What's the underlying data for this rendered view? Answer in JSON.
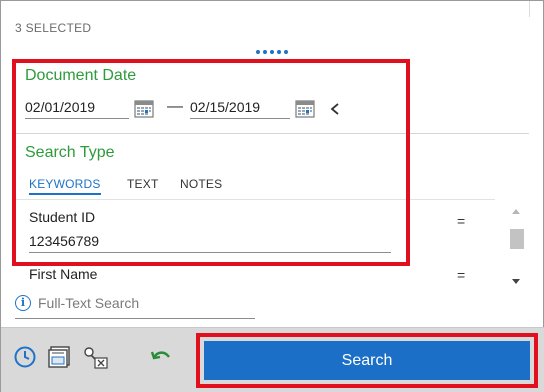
{
  "header": {
    "selected_count": "3 SELECTED"
  },
  "document_date": {
    "title": "Document Date",
    "from": "02/01/2019",
    "to": "02/15/2019",
    "separator": "—"
  },
  "search_type": {
    "title": "Search Type",
    "tabs": [
      {
        "label": "KEYWORDS",
        "active": true
      },
      {
        "label": "TEXT",
        "active": false
      },
      {
        "label": "NOTES",
        "active": false
      }
    ]
  },
  "fields": [
    {
      "label": "Student ID",
      "value": "123456789",
      "operator": "="
    },
    {
      "label": "First Name",
      "value": "",
      "operator": "="
    }
  ],
  "fulltext": {
    "info_glyph": "i",
    "placeholder": "Full-Text Search"
  },
  "footer": {
    "icons": [
      "history-icon",
      "records-icon",
      "permissions-icon",
      "undo-icon"
    ],
    "search_label": "Search"
  },
  "colors": {
    "accent": "#1c6fc6",
    "section_title": "#2e9b3b",
    "highlight": "#e0101e",
    "footer_bg": "#d9d9d9"
  }
}
